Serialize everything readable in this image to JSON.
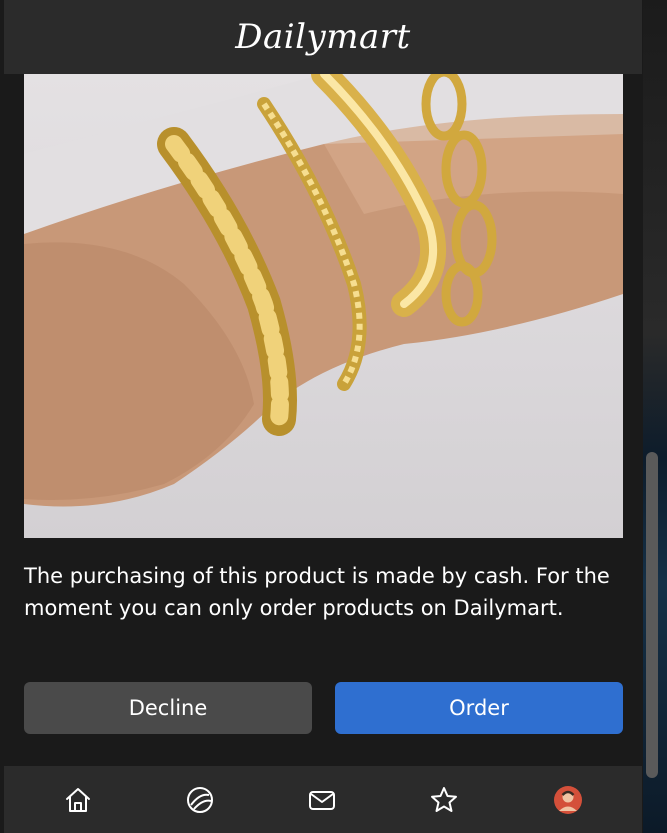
{
  "header": {
    "logo_text": "Dailymart"
  },
  "product": {
    "image_alt": "gold-bracelets-on-wrist-photo",
    "description": "The purchasing of this product is made by cash. For the moment you can only order products on Dailymart."
  },
  "actions": {
    "decline_label": "Decline",
    "order_label": "Order"
  },
  "tabbar": {
    "items": [
      {
        "icon": "home-icon"
      },
      {
        "icon": "explore-icon"
      },
      {
        "icon": "mail-icon"
      },
      {
        "icon": "star-icon"
      },
      {
        "icon": "profile-avatar"
      }
    ]
  },
  "colors": {
    "background": "#1a1a1a",
    "header": "#2b2b2b",
    "decline_button": "#4a4a4a",
    "order_button": "#2f6fd0",
    "text": "#ffffff"
  }
}
